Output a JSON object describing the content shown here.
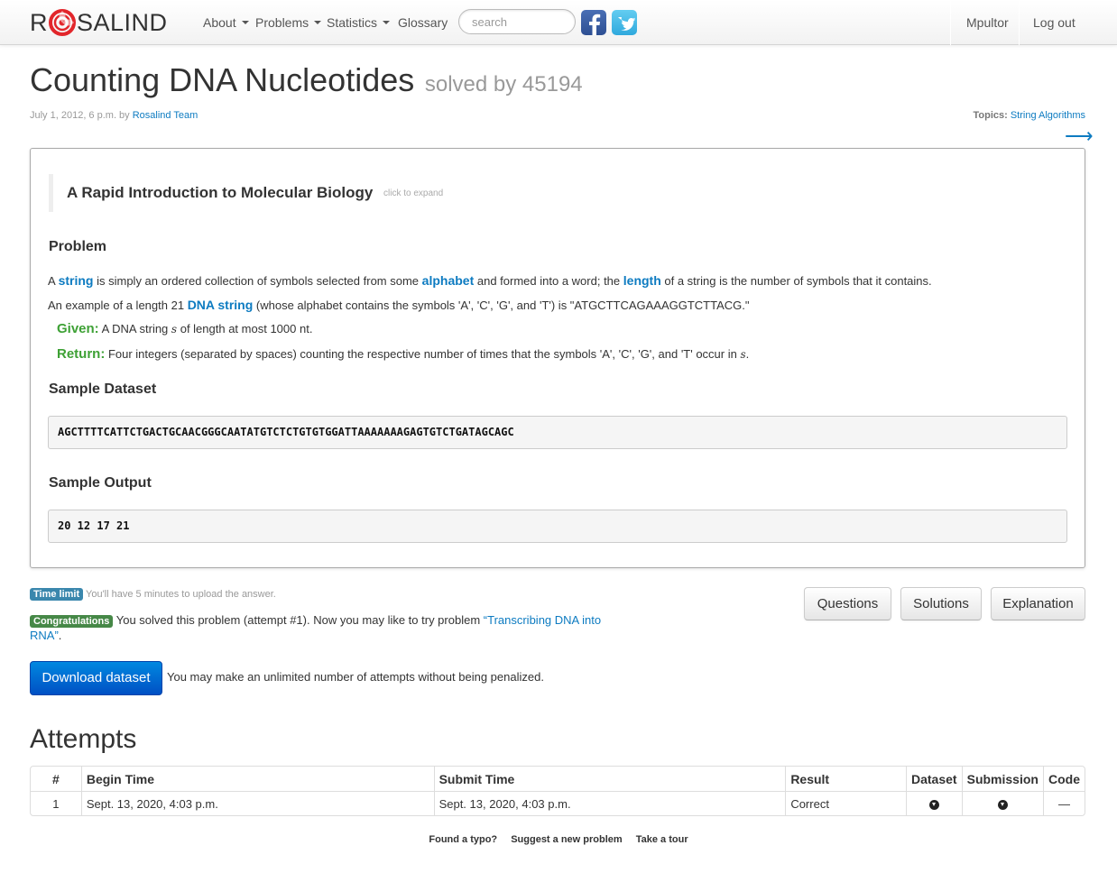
{
  "nav": {
    "brand_left": "R",
    "brand_right": "SALIND",
    "items": [
      "About",
      "Problems",
      "Statistics",
      "Glossary"
    ],
    "search_placeholder": "search",
    "user": "Mpultor",
    "logout": "Log out"
  },
  "header": {
    "title": "Counting DNA Nucleotides",
    "solved": "solved by 45194",
    "date": "July 1, 2012, 6 p.m. by",
    "author": "Rosalind Team",
    "topics_label": "Topics:",
    "topics_value": "String Algorithms",
    "next_arrow": "⟶"
  },
  "problem": {
    "intro_title": "A Rapid Introduction to Molecular Biology",
    "intro_hint": "click to expand",
    "heading": "Problem",
    "p1": {
      "t1": "A",
      "k1": "string",
      "t2": "is simply an ordered collection of symbols selected from some",
      "k2": "alphabet",
      "t3": "and formed into a word; the",
      "k3": "length",
      "t4": "of a string is the number of symbols that it contains."
    },
    "p2": {
      "t1": "An example of a length 21",
      "k1": "DNA string",
      "t2": "(whose alphabet contains the symbols 'A', 'C', 'G', and 'T') is \"ATGCTTCAGAAAGGTCTTACG.\""
    },
    "given_label": "Given:",
    "given_text_a": "A DNA string",
    "given_var": "s",
    "given_text_b": "of length at most 1000 nt.",
    "return_label": "Return:",
    "return_text_a": "Four integers (separated by spaces) counting the respective number of times that the symbols 'A', 'C', 'G', and 'T' occur in",
    "return_var": "s",
    "return_text_b": ".",
    "sample_dataset_heading": "Sample Dataset",
    "sample_dataset": "AGCTTTTCATTCTGACTGCAACGGGCAATATGTCTCTGTGTGGATTAAAAAAAGAGTGTCTGATAGCAGC",
    "sample_output_heading": "Sample Output",
    "sample_output": "20 12 17 21"
  },
  "status": {
    "time_label": "Time limit",
    "time_text": "You'll have 5 minutes to upload the answer.",
    "congrats_label": "Congratulations",
    "congrats_text": "You solved this problem (attempt #1). Now you may like to try problem",
    "next_problem": "“Transcribing DNA into RNA”",
    "congrats_end": ".",
    "btn_questions": "Questions",
    "btn_solutions": "Solutions",
    "btn_explanation": "Explanation",
    "download": "Download dataset",
    "unlimited": "You may make an unlimited number of attempts without being penalized."
  },
  "attempts": {
    "heading": "Attempts",
    "columns": [
      "#",
      "Begin Time",
      "Submit Time",
      "Result",
      "Dataset",
      "Submission",
      "Code"
    ],
    "rows": [
      {
        "n": "1",
        "begin": "Sept. 13, 2020, 4:03 p.m.",
        "submit": "Sept. 13, 2020, 4:03 p.m.",
        "result": "Correct",
        "code": "—"
      }
    ]
  },
  "footer": [
    "Found a typo?",
    "Suggest a new problem",
    "Take a tour"
  ]
}
